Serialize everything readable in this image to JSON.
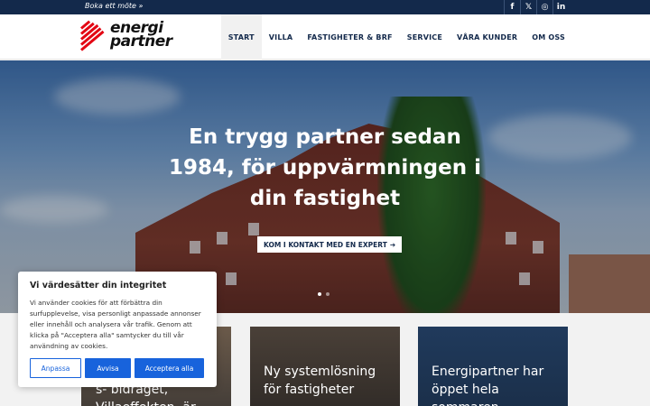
{
  "topbar": {
    "booking_link": "Boka ett möte",
    "booking_arrow": "»",
    "socials": [
      {
        "icon": "facebook-icon",
        "glyph": "f"
      },
      {
        "icon": "x-icon",
        "glyph": "𝕏"
      },
      {
        "icon": "instagram-icon",
        "glyph": "◎"
      },
      {
        "icon": "linkedin-icon",
        "glyph": "in"
      }
    ]
  },
  "brand": {
    "logo_line1": "energi",
    "logo_line2": "partner",
    "accent_color": "#e30613",
    "navy_color": "#13294b"
  },
  "nav": {
    "items": [
      {
        "label": "START",
        "active": true
      },
      {
        "label": "VILLA",
        "active": false
      },
      {
        "label": "FASTIGHETER & BRF",
        "active": false
      },
      {
        "label": "SERVICE",
        "active": false
      },
      {
        "label": "VÅRA KUNDER",
        "active": false
      },
      {
        "label": "OM OSS",
        "active": false
      }
    ]
  },
  "hero": {
    "title_line1": "En trygg partner sedan",
    "title_line2": "1984, för uppvärmningen i",
    "title_line3": "din fastighet",
    "cta_label": "KOM I KONTAKT MED EN EXPERT",
    "cta_icon": "arrow-right-icon",
    "cta_glyph": "➔"
  },
  "cards": [
    {
      "line1": "s- bidraget,",
      "line2": "Villaeffekten, är"
    },
    {
      "line1": "Ny systemlösning",
      "line2": "för fastigheter"
    },
    {
      "line1": "Energipartner har",
      "line2": "öppet hela",
      "line3": "sommaren"
    }
  ],
  "cookie": {
    "title": "Vi värdesätter din integritet",
    "text": "Vi använder cookies för att förbättra din surfupplevelse, visa personligt anpassade annonser eller innehåll och analysera vår trafik. Genom att klicka på \"Acceptera alla\" samtycker du till vår användning av cookies.",
    "customize_label": "Anpassa",
    "reject_label": "Avvisa",
    "accept_label": "Acceptera alla",
    "button_color": "#1863dc"
  }
}
